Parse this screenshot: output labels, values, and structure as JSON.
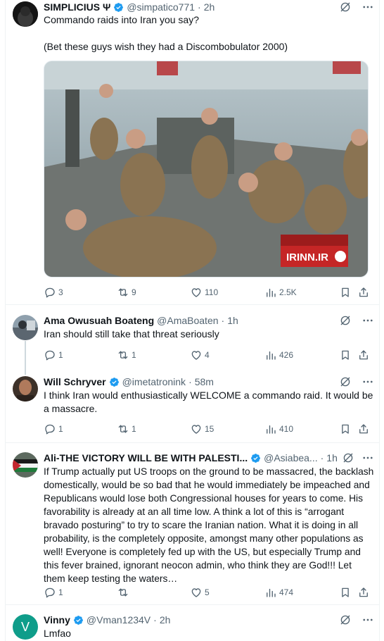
{
  "tweets": [
    {
      "name": "SIMPLICIUS Ψ",
      "handle": "@simpatico771",
      "time": "2h",
      "text": "Commando raids into Iran you say?\n\n(Bet these guys wish they had a Discombobulator 2000)",
      "media": {
        "watermark": "IRINN.IR"
      },
      "replies": "3",
      "retweets": "9",
      "likes": "110",
      "views": "2.5K"
    },
    {
      "name": "Ama Owusuah Boateng",
      "handle": "@AmaBoaten",
      "time": "1h",
      "text": "Iran should still take that threat seriously",
      "replies": "1",
      "retweets": "1",
      "likes": "4",
      "views": "426"
    },
    {
      "name": "Will Schryver",
      "handle": "@imetatronink",
      "time": "58m",
      "text": "I think Iran would enthusiastically WELCOME a commando raid. It would be a massacre.",
      "replies": "1",
      "retweets": "1",
      "likes": "15",
      "views": "410"
    },
    {
      "name": "Ali-THE VICTORY WILL BE WITH PALESTI...",
      "handle": "@Asiabea...",
      "time": "1h",
      "text": "If Trump actually put US troops on the ground to be massacred, the backlash domestically, would be so bad that he would immediately be impeached and Republicans would lose both Congressional houses for years to come. His favorability is already at an all time low. A think a lot of this is “arrogant bravado posturing” to try to scare the Iranian nation. What it is doing in all probability, is the completely opposite, amongst many other populations as well! Everyone is completely fed up with the US, but especially Trump and this fever brained, ignorant neocon admin, who think they are God!!! Let them keep testing the waters…",
      "replies": "1",
      "retweets": "",
      "likes": "5",
      "views": "474"
    },
    {
      "name": "Vinny",
      "handle": "@Vman1234V",
      "time": "2h",
      "text": "Lmfao",
      "avatar_letter": "V"
    }
  ],
  "sep": "·",
  "colors": {
    "verified": "#1d9bf0",
    "muted": "#536471",
    "text": "#0f1419",
    "vinny_avatar": "#0f9d8a"
  },
  "icons": [
    "verified-badge-icon",
    "grok-icon",
    "more-icon",
    "reply-icon",
    "retweet-icon",
    "like-icon",
    "views-icon",
    "bookmark-icon",
    "share-icon"
  ]
}
